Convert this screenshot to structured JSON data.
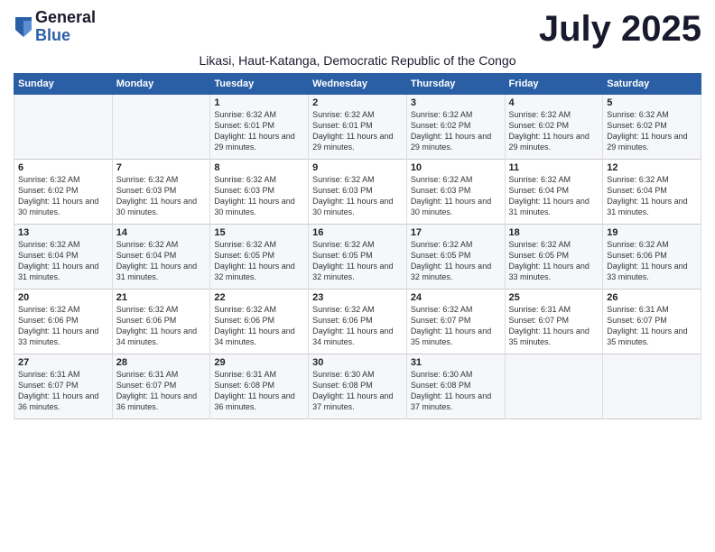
{
  "header": {
    "logo_general": "General",
    "logo_blue": "Blue",
    "month_title": "July 2025",
    "subtitle": "Likasi, Haut-Katanga, Democratic Republic of the Congo"
  },
  "columns": [
    "Sunday",
    "Monday",
    "Tuesday",
    "Wednesday",
    "Thursday",
    "Friday",
    "Saturday"
  ],
  "weeks": [
    [
      {
        "day": "",
        "info": ""
      },
      {
        "day": "",
        "info": ""
      },
      {
        "day": "1",
        "info": "Sunrise: 6:32 AM\nSunset: 6:01 PM\nDaylight: 11 hours and 29 minutes."
      },
      {
        "day": "2",
        "info": "Sunrise: 6:32 AM\nSunset: 6:01 PM\nDaylight: 11 hours and 29 minutes."
      },
      {
        "day": "3",
        "info": "Sunrise: 6:32 AM\nSunset: 6:02 PM\nDaylight: 11 hours and 29 minutes."
      },
      {
        "day": "4",
        "info": "Sunrise: 6:32 AM\nSunset: 6:02 PM\nDaylight: 11 hours and 29 minutes."
      },
      {
        "day": "5",
        "info": "Sunrise: 6:32 AM\nSunset: 6:02 PM\nDaylight: 11 hours and 29 minutes."
      }
    ],
    [
      {
        "day": "6",
        "info": "Sunrise: 6:32 AM\nSunset: 6:02 PM\nDaylight: 11 hours and 30 minutes."
      },
      {
        "day": "7",
        "info": "Sunrise: 6:32 AM\nSunset: 6:03 PM\nDaylight: 11 hours and 30 minutes."
      },
      {
        "day": "8",
        "info": "Sunrise: 6:32 AM\nSunset: 6:03 PM\nDaylight: 11 hours and 30 minutes."
      },
      {
        "day": "9",
        "info": "Sunrise: 6:32 AM\nSunset: 6:03 PM\nDaylight: 11 hours and 30 minutes."
      },
      {
        "day": "10",
        "info": "Sunrise: 6:32 AM\nSunset: 6:03 PM\nDaylight: 11 hours and 30 minutes."
      },
      {
        "day": "11",
        "info": "Sunrise: 6:32 AM\nSunset: 6:04 PM\nDaylight: 11 hours and 31 minutes."
      },
      {
        "day": "12",
        "info": "Sunrise: 6:32 AM\nSunset: 6:04 PM\nDaylight: 11 hours and 31 minutes."
      }
    ],
    [
      {
        "day": "13",
        "info": "Sunrise: 6:32 AM\nSunset: 6:04 PM\nDaylight: 11 hours and 31 minutes."
      },
      {
        "day": "14",
        "info": "Sunrise: 6:32 AM\nSunset: 6:04 PM\nDaylight: 11 hours and 31 minutes."
      },
      {
        "day": "15",
        "info": "Sunrise: 6:32 AM\nSunset: 6:05 PM\nDaylight: 11 hours and 32 minutes."
      },
      {
        "day": "16",
        "info": "Sunrise: 6:32 AM\nSunset: 6:05 PM\nDaylight: 11 hours and 32 minutes."
      },
      {
        "day": "17",
        "info": "Sunrise: 6:32 AM\nSunset: 6:05 PM\nDaylight: 11 hours and 32 minutes."
      },
      {
        "day": "18",
        "info": "Sunrise: 6:32 AM\nSunset: 6:05 PM\nDaylight: 11 hours and 33 minutes."
      },
      {
        "day": "19",
        "info": "Sunrise: 6:32 AM\nSunset: 6:06 PM\nDaylight: 11 hours and 33 minutes."
      }
    ],
    [
      {
        "day": "20",
        "info": "Sunrise: 6:32 AM\nSunset: 6:06 PM\nDaylight: 11 hours and 33 minutes."
      },
      {
        "day": "21",
        "info": "Sunrise: 6:32 AM\nSunset: 6:06 PM\nDaylight: 11 hours and 34 minutes."
      },
      {
        "day": "22",
        "info": "Sunrise: 6:32 AM\nSunset: 6:06 PM\nDaylight: 11 hours and 34 minutes."
      },
      {
        "day": "23",
        "info": "Sunrise: 6:32 AM\nSunset: 6:06 PM\nDaylight: 11 hours and 34 minutes."
      },
      {
        "day": "24",
        "info": "Sunrise: 6:32 AM\nSunset: 6:07 PM\nDaylight: 11 hours and 35 minutes."
      },
      {
        "day": "25",
        "info": "Sunrise: 6:31 AM\nSunset: 6:07 PM\nDaylight: 11 hours and 35 minutes."
      },
      {
        "day": "26",
        "info": "Sunrise: 6:31 AM\nSunset: 6:07 PM\nDaylight: 11 hours and 35 minutes."
      }
    ],
    [
      {
        "day": "27",
        "info": "Sunrise: 6:31 AM\nSunset: 6:07 PM\nDaylight: 11 hours and 36 minutes."
      },
      {
        "day": "28",
        "info": "Sunrise: 6:31 AM\nSunset: 6:07 PM\nDaylight: 11 hours and 36 minutes."
      },
      {
        "day": "29",
        "info": "Sunrise: 6:31 AM\nSunset: 6:08 PM\nDaylight: 11 hours and 36 minutes."
      },
      {
        "day": "30",
        "info": "Sunrise: 6:30 AM\nSunset: 6:08 PM\nDaylight: 11 hours and 37 minutes."
      },
      {
        "day": "31",
        "info": "Sunrise: 6:30 AM\nSunset: 6:08 PM\nDaylight: 11 hours and 37 minutes."
      },
      {
        "day": "",
        "info": ""
      },
      {
        "day": "",
        "info": ""
      }
    ]
  ]
}
